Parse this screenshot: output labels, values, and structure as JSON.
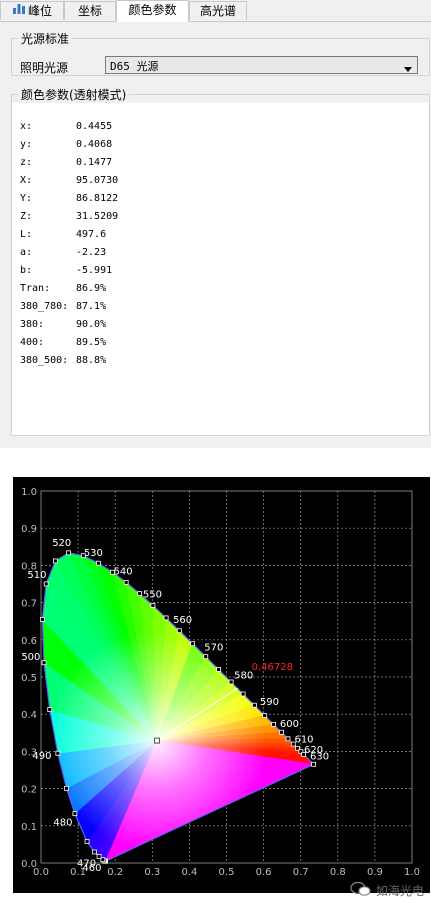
{
  "tabs": [
    {
      "label": "峰位",
      "icon": "chart-bar-icon",
      "active": false
    },
    {
      "label": "坐标",
      "active": false
    },
    {
      "label": "颜色参数",
      "active": true
    },
    {
      "label": "高光谱",
      "active": false
    }
  ],
  "illuminant": {
    "group_title": "光源标准",
    "label": "照明光源",
    "selected": "D65 光源"
  },
  "params": {
    "group_title": "颜色参数(透射模式)",
    "rows": [
      {
        "key": "x:",
        "value": "0.4455"
      },
      {
        "key": "y:",
        "value": "0.4068"
      },
      {
        "key": "z:",
        "value": "0.1477"
      },
      {
        "key": "X:",
        "value": "95.0730"
      },
      {
        "key": "Y:",
        "value": "86.8122"
      },
      {
        "key": "Z:",
        "value": "31.5209"
      },
      {
        "key": "L:",
        "value": "497.6"
      },
      {
        "key": "a:",
        "value": "-2.23"
      },
      {
        "key": "b:",
        "value": "-5.991"
      },
      {
        "key": "Tran:",
        "value": "86.9%"
      },
      {
        "key": "380_780:",
        "value": "87.1%"
      },
      {
        "key": "380:",
        "value": "90.0%"
      },
      {
        "key": "400:",
        "value": "89.5%"
      },
      {
        "key": "380_500:",
        "value": "88.8%"
      }
    ]
  },
  "chart_data": {
    "type": "scatter",
    "title": "",
    "xlabel": "",
    "ylabel": "",
    "xlim": [
      0,
      1.0
    ],
    "ylim": [
      0,
      1.0
    ],
    "grid": true,
    "x_ticks": [
      "0.0",
      "0.1",
      "0.2",
      "0.3",
      "0.4",
      "0.5",
      "0.6",
      "0.7",
      "0.8",
      "0.9",
      "1.0"
    ],
    "y_ticks": [
      "0.0",
      "0.1",
      "0.2",
      "0.3",
      "0.4",
      "0.5",
      "0.6",
      "0.7",
      "0.8",
      "0.9",
      "1.0"
    ],
    "spectral_locus": [
      {
        "x": 0.1741,
        "y": 0.005,
        "label": ""
      },
      {
        "x": 0.173,
        "y": 0.005,
        "label": ""
      },
      {
        "x": 0.1721,
        "y": 0.0048,
        "label": ""
      },
      {
        "x": 0.1703,
        "y": 0.0058,
        "label": ""
      },
      {
        "x": 0.1666,
        "y": 0.0089,
        "label": ""
      },
      {
        "x": 0.1566,
        "y": 0.0177,
        "label": "460"
      },
      {
        "x": 0.144,
        "y": 0.0297,
        "label": "470"
      },
      {
        "x": 0.1241,
        "y": 0.0578,
        "label": ""
      },
      {
        "x": 0.0913,
        "y": 0.1327,
        "label": "480"
      },
      {
        "x": 0.0687,
        "y": 0.2007,
        "label": ""
      },
      {
        "x": 0.0454,
        "y": 0.295,
        "label": "490"
      },
      {
        "x": 0.0235,
        "y": 0.4127,
        "label": ""
      },
      {
        "x": 0.0082,
        "y": 0.5384,
        "label": "500"
      },
      {
        "x": 0.0039,
        "y": 0.6548,
        "label": ""
      },
      {
        "x": 0.0139,
        "y": 0.7502,
        "label": "510"
      },
      {
        "x": 0.0389,
        "y": 0.812,
        "label": ""
      },
      {
        "x": 0.0743,
        "y": 0.8338,
        "label": "520"
      },
      {
        "x": 0.1142,
        "y": 0.8262,
        "label": ""
      },
      {
        "x": 0.1547,
        "y": 0.8059,
        "label": "530"
      },
      {
        "x": 0.1929,
        "y": 0.7816,
        "label": ""
      },
      {
        "x": 0.2296,
        "y": 0.7543,
        "label": "540"
      },
      {
        "x": 0.2658,
        "y": 0.7243,
        "label": ""
      },
      {
        "x": 0.3016,
        "y": 0.6923,
        "label": "550"
      },
      {
        "x": 0.3373,
        "y": 0.6589,
        "label": ""
      },
      {
        "x": 0.3731,
        "y": 0.6245,
        "label": "560"
      },
      {
        "x": 0.4087,
        "y": 0.5896,
        "label": ""
      },
      {
        "x": 0.4441,
        "y": 0.5547,
        "label": "570"
      },
      {
        "x": 0.4788,
        "y": 0.5202,
        "label": ""
      },
      {
        "x": 0.5125,
        "y": 0.4866,
        "label": "580"
      },
      {
        "x": 0.5448,
        "y": 0.4544,
        "label": ""
      },
      {
        "x": 0.5752,
        "y": 0.4242,
        "label": "590"
      },
      {
        "x": 0.6029,
        "y": 0.3965,
        "label": ""
      },
      {
        "x": 0.627,
        "y": 0.3725,
        "label": "600"
      },
      {
        "x": 0.6482,
        "y": 0.3514,
        "label": ""
      },
      {
        "x": 0.6658,
        "y": 0.334,
        "label": "610"
      },
      {
        "x": 0.6801,
        "y": 0.3197,
        "label": ""
      },
      {
        "x": 0.6915,
        "y": 0.3083,
        "label": "620"
      },
      {
        "x": 0.7006,
        "y": 0.2993,
        "label": ""
      },
      {
        "x": 0.7079,
        "y": 0.292,
        "label": "630"
      },
      {
        "x": 0.7347,
        "y": 0.2653,
        "label": ""
      }
    ],
    "white_point": {
      "x": 0.3127,
      "y": 0.329
    },
    "dominant_wavelength_point": {
      "x": 0.53,
      "y": 0.47
    },
    "annotation": {
      "text": "0.46728",
      "color": "#ff2020"
    }
  },
  "watermark": {
    "icon": "wechat-icon",
    "text": "如海光电"
  }
}
